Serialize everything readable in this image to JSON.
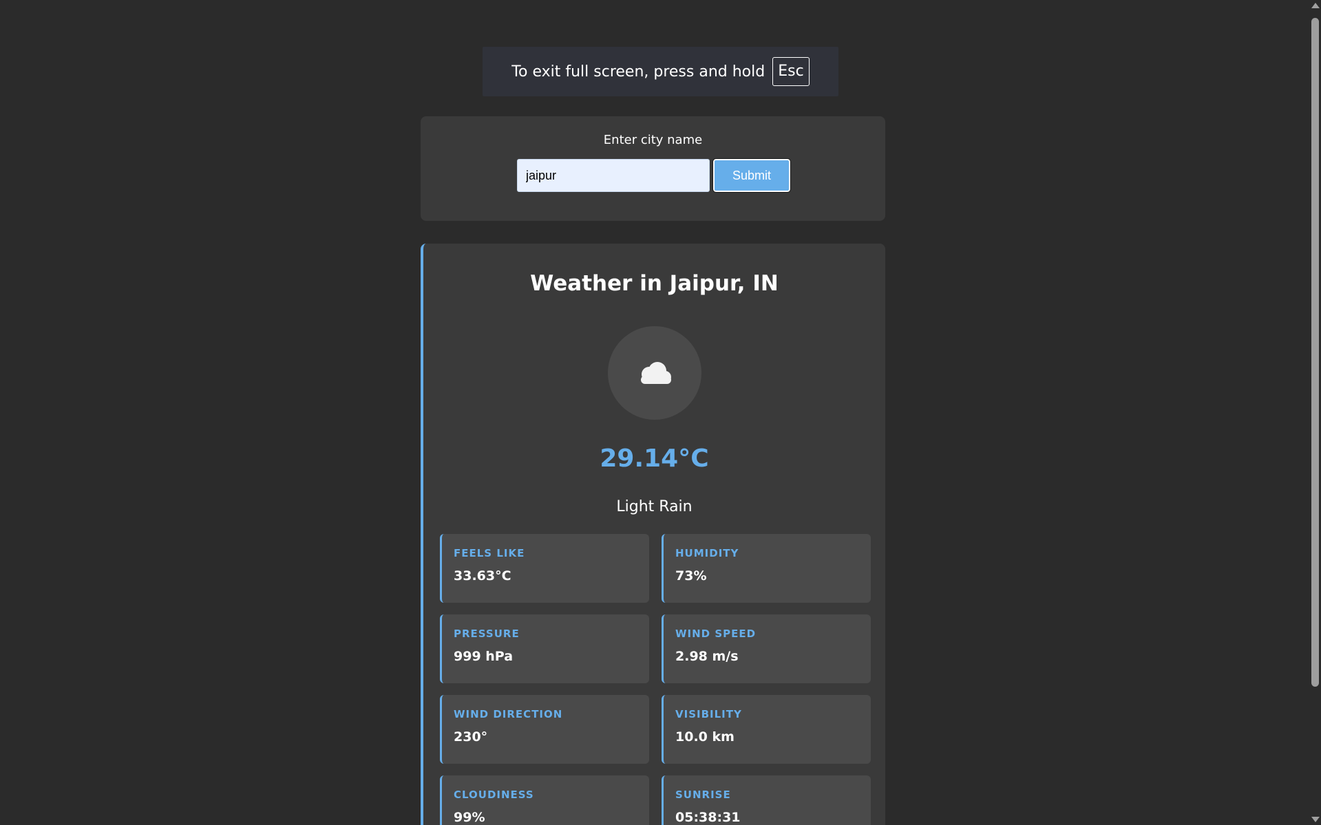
{
  "fullscreen_notice": {
    "text": "To exit full screen, press and hold",
    "key": "Esc"
  },
  "search": {
    "label": "Enter city name",
    "value": "jaipur",
    "submit_label": "Submit"
  },
  "weather": {
    "title": "Weather in Jaipur, IN",
    "icon": "cloud-icon",
    "temperature": "29.14°C",
    "description": "Light Rain",
    "details": [
      {
        "label": "FEELS LIKE",
        "value": "33.63°C"
      },
      {
        "label": "HUMIDITY",
        "value": "73%"
      },
      {
        "label": "PRESSURE",
        "value": "999 hPa"
      },
      {
        "label": "WIND SPEED",
        "value": "2.98 m/s"
      },
      {
        "label": "WIND DIRECTION",
        "value": "230°"
      },
      {
        "label": "VISIBILITY",
        "value": "10.0 km"
      },
      {
        "label": "CLOUDINESS",
        "value": "99%"
      },
      {
        "label": "SUNRISE",
        "value": "05:38:31"
      }
    ]
  },
  "colors": {
    "background": "#2b2b2b",
    "card": "#3a3a3a",
    "detail_card": "#4a4a4a",
    "accent": "#66aeea"
  }
}
